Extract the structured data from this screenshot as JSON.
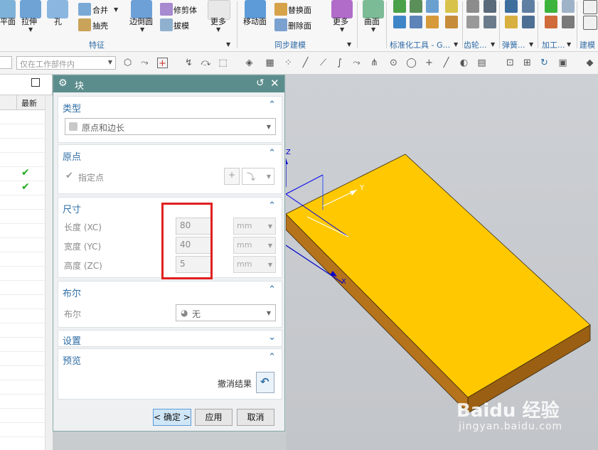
{
  "ribbon": {
    "items": [
      {
        "label": "平面"
      },
      {
        "label": "拉伸"
      },
      {
        "label": "孔"
      },
      {
        "label": "合并"
      },
      {
        "label": "抽壳"
      },
      {
        "label": "边倒圆"
      },
      {
        "label": "修剪体"
      },
      {
        "label": "拔模"
      },
      {
        "label": "更多"
      },
      {
        "label": "移动面"
      },
      {
        "label": "替换面"
      },
      {
        "label": "删除面"
      },
      {
        "label": "更多"
      },
      {
        "label": "曲面"
      }
    ],
    "groups": [
      "特征",
      "同步建模",
      "标准化工具 - G...",
      "齿轮...",
      "弹簧...",
      "加工...",
      "建模"
    ]
  },
  "toolbar": {
    "filter_placeholder": "仅在工作部件内"
  },
  "navigator": {
    "col_header": "最新",
    "checks": 2
  },
  "dialog": {
    "title": "块",
    "sections": {
      "type": {
        "heading": "类型",
        "value": "原点和边长"
      },
      "origin": {
        "heading": "原点",
        "specify_point": "指定点"
      },
      "dimensions": {
        "heading": "尺寸",
        "rows": [
          {
            "label": "长度 (XC)",
            "value": "80",
            "unit": "mm"
          },
          {
            "label": "宽度 (YC)",
            "value": "40",
            "unit": "mm"
          },
          {
            "label": "高度 (ZC)",
            "value": "5",
            "unit": "mm"
          }
        ]
      },
      "boolean": {
        "heading": "布尔",
        "label": "布尔",
        "value": "无"
      },
      "settings": {
        "heading": "设置"
      },
      "preview": {
        "heading": "预览",
        "undo_label": "撤消结果"
      }
    },
    "buttons": {
      "ok": "< 确定 >",
      "apply": "应用",
      "cancel": "取消"
    }
  },
  "viewport": {
    "axis_z": "Z",
    "axis_y": "Y",
    "axis_x": "X",
    "block_color": "#ffc800",
    "block_side_color": "#b5731c"
  },
  "watermark": {
    "brand": "Baidu 经验",
    "url": "jingyan.baidu.com"
  },
  "colors": {
    "accent": "#2e6da4",
    "title_bar": "#5b8d8c",
    "highlight_box": "#e02020",
    "check": "#22aa22"
  }
}
